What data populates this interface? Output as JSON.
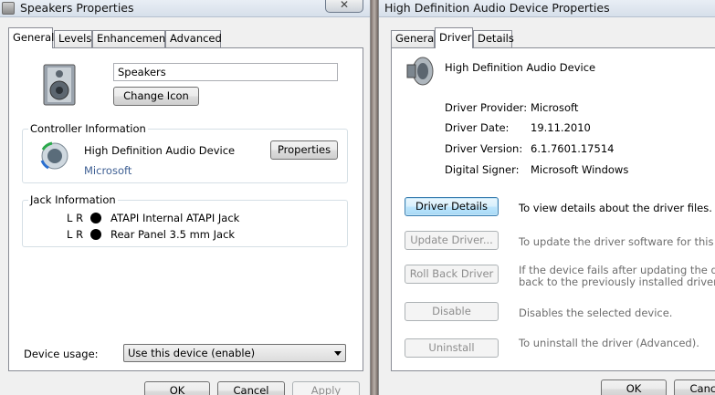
{
  "left": {
    "title": "Speakers Properties",
    "close_glyph": "✕",
    "tabs": [
      "General",
      "Levels",
      "Enhancements",
      "Advanced"
    ],
    "device_name_value": "Speakers",
    "change_icon_label": "Change Icon",
    "controller": {
      "group_label": "Controller Information",
      "device": "High Definition Audio Device",
      "vendor": "Microsoft",
      "properties_label": "Properties"
    },
    "jack": {
      "group_label": "Jack Information",
      "rows": [
        {
          "channels": "L R",
          "name": "ATAPI Internal ATAPI Jack"
        },
        {
          "channels": "L R",
          "name": "Rear Panel 3.5 mm Jack"
        }
      ]
    },
    "device_usage_label": "Device usage:",
    "device_usage_value": "Use this device (enable)",
    "buttons": {
      "ok": "OK",
      "cancel": "Cancel",
      "apply": "Apply"
    }
  },
  "right": {
    "title": "High Definition Audio Device Properties",
    "tabs": [
      "General",
      "Driver",
      "Details"
    ],
    "device": "High Definition Audio Device",
    "info": [
      {
        "label": "Driver Provider:",
        "value": "Microsoft"
      },
      {
        "label": "Driver Date:",
        "value": "19.11.2010"
      },
      {
        "label": "Driver Version:",
        "value": "6.1.7601.17514"
      },
      {
        "label": "Digital Signer:",
        "value": "Microsoft Windows"
      }
    ],
    "actions": [
      {
        "label": "Driver Details",
        "desc": "To view details about the driver files."
      },
      {
        "label": "Update Driver...",
        "desc": "To update the driver software for this device."
      },
      {
        "label": "Roll Back Driver",
        "desc_line1": "If the device fails after updating the driver, roll",
        "desc_line2": "back to the previously installed driver."
      },
      {
        "label": "Disable",
        "desc": "Disables the selected device."
      },
      {
        "label": "Uninstall",
        "desc": "To uninstall the driver (Advanced)."
      }
    ],
    "buttons": {
      "ok": "OK",
      "cancel": "Cancel"
    }
  },
  "icons": {
    "window_icon": "speaker-window-icon",
    "device_icon": "speaker-icon",
    "controller_icon": "audio-controller-icon",
    "jack_indicator": "jack-dot-icon"
  }
}
